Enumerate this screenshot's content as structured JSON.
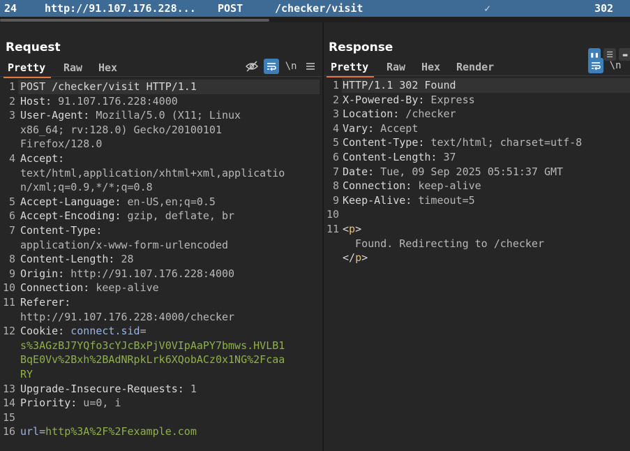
{
  "topbar": {
    "index": "24",
    "host": "http://91.107.176.228...",
    "method": "POST",
    "path": "/checker/visit",
    "status": "302",
    "check_icon": "check-icon"
  },
  "request": {
    "title": "Request",
    "tabs": [
      "Pretty",
      "Raw",
      "Hex"
    ],
    "active_tab": "Pretty",
    "icons": [
      "hide-icon",
      "wrap-icon",
      "newline-icon",
      "menu-icon"
    ],
    "newline_label": "\\n",
    "line_numbers": [
      "1",
      "2",
      "3",
      "4",
      "5",
      "6",
      "7",
      "8",
      "9",
      "10",
      "11",
      "12",
      "13",
      "14",
      "15",
      "16"
    ],
    "lines": {
      "l1": "POST /checker/visit HTTP/1.1",
      "l2k": "Host:",
      "l2v": " 91.107.176.228:4000",
      "l3k": "User-Agent:",
      "l3v": " Mozilla/5.0 (X11; Linux",
      "l3w1": "x86_64; rv:128.0) Gecko/20100101",
      "l3w2": "Firefox/128.0",
      "l4k": "Accept:",
      "l4w1": "text/html,application/xhtml+xml,applicatio",
      "l4w2": "n/xml;q=0.9,*/*;q=0.8",
      "l5k": "Accept-Language:",
      "l5v": " en-US,en;q=0.5",
      "l6k": "Accept-Encoding:",
      "l6v": " gzip, deflate, br",
      "l7k": "Content-Type:",
      "l7w1": "application/x-www-form-urlencoded",
      "l8k": "Content-Length:",
      "l8v": " 28",
      "l9k": "Origin:",
      "l9v": " http://91.107.176.228:4000",
      "l10k": "Connection:",
      "l10v": " keep-alive",
      "l11k": "Referer:",
      "l11w1": "http://91.107.176.228:4000/checker",
      "l12k": "Cookie:",
      "l12n": " connect.sid",
      "l12eq": "=",
      "l12w1": "s%3AGzBJ7YQfo3cYJcBxPjV0VIpAaPY7bmws.HVLB1",
      "l12w2": "BqE0Vv%2Bxh%2BAdNRpkLrk6XQobACz0x1NG%2Fcaa",
      "l12w3": "RY",
      "l13k": "Upgrade-Insecure-Requests:",
      "l13v": " 1",
      "l14k": "Priority:",
      "l14v": " u=0, i",
      "l16n": "url",
      "l16eq": "=",
      "l16v": "http%3A%2F%2Fexample.com"
    }
  },
  "response": {
    "title": "Response",
    "tabs": [
      "Pretty",
      "Raw",
      "Hex",
      "Render"
    ],
    "active_tab": "Pretty",
    "icons": [
      "wrap-icon",
      "newline-icon"
    ],
    "newline_label": "\\n",
    "line_numbers": [
      "1",
      "2",
      "3",
      "4",
      "5",
      "6",
      "7",
      "8",
      "9",
      "10",
      "11"
    ],
    "lines": {
      "l1": "HTTP/1.1 302 Found",
      "l2k": "X-Powered-By:",
      "l2v": " Express",
      "l3k": "Location:",
      "l3v": " /checker",
      "l4k": "Vary:",
      "l4v": " Accept",
      "l5k": "Content-Type:",
      "l5v": " text/html; charset=utf-8",
      "l6k": "Content-Length:",
      "l6v": " 37",
      "l7k": "Date:",
      "l7v": " Tue, 09 Sep 2025 05:51:37 GMT",
      "l8k": "Connection:",
      "l8v": " keep-alive",
      "l9k": "Keep-Alive:",
      "l9v": " timeout=5",
      "l11open_lt": "<",
      "l11open_tag": "p",
      "l11open_gt": ">",
      "l11body": "  Found. Redirecting to /checker",
      "l11close_lt": "</",
      "l11close_tag": "p",
      "l11close_gt": ">"
    }
  },
  "colors": {
    "topbar": "#3d6b96",
    "accent": "#e8743b",
    "toggle_on": "#3d7fb8",
    "value_green": "#8fb04a",
    "param_blue": "#9ab4e6",
    "tag_yellow": "#e5c07b"
  }
}
